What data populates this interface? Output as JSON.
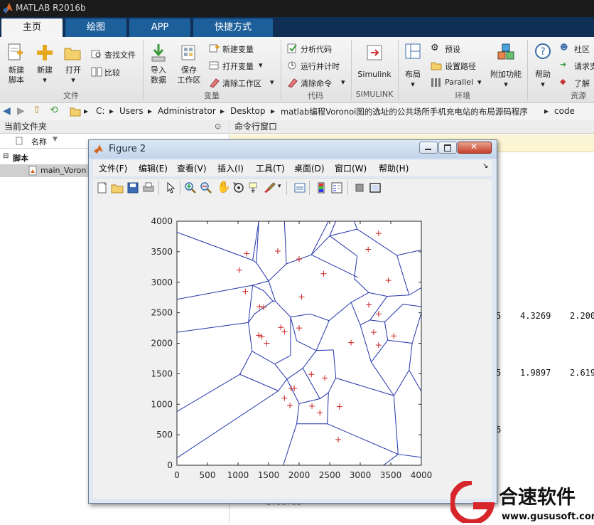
{
  "window": {
    "title": "MATLAB R2016b"
  },
  "tabs": [
    {
      "label": "主页",
      "active": true
    },
    {
      "label": "绘图",
      "active": false
    },
    {
      "label": "APP",
      "active": false
    },
    {
      "label": "快捷方式",
      "active": false
    }
  ],
  "ribbon": {
    "file": {
      "group_label": "文件",
      "new_script": "新建\n脚本",
      "new": "新建",
      "open": "打开",
      "find_files": "查找文件",
      "compare": "比较"
    },
    "variable": {
      "group_label": "变量",
      "import_data": "导入\n数据",
      "save_workspace": "保存\n工作区",
      "new_variable": "新建变量",
      "open_variable": "打开变量",
      "clear_workspace": "清除工作区"
    },
    "code": {
      "group_label": "代码",
      "analyze_code": "分析代码",
      "run_and_time": "运行并计时",
      "clear_commands": "清除命令"
    },
    "simulink": {
      "group_label": "SIMULINK",
      "simulink": "Simulink"
    },
    "environment": {
      "group_label": "环境",
      "layout": "布局",
      "preferences": "预设",
      "set_path": "设置路径",
      "parallel": "Parallel",
      "addons": "附加功能"
    },
    "resources": {
      "group_label": "资源",
      "help": "帮助",
      "community": "社区",
      "request_support": "请求支",
      "learn": "了解"
    }
  },
  "address": {
    "path": [
      "C:",
      "Users",
      "Administrator",
      "Desktop",
      "matlab编程Voronoi图的选址的公共场所手机充电站的布局源码程序",
      "code"
    ]
  },
  "current_folder": {
    "title": "当前文件夹",
    "column_name": "名称",
    "sort_indicator": "▼",
    "group": "脚本",
    "items": [
      {
        "name": "main_Voron"
      }
    ]
  },
  "command_window": {
    "title": "命令行窗口",
    "row1": [
      "5",
      "4.3269",
      "2.200"
    ],
    "row2": [
      "5",
      "1.9897",
      "2.619"
    ],
    "row3": [
      "6"
    ],
    "bottom_line": "1.0e+03"
  },
  "figure": {
    "title": "Figure 2",
    "menus": [
      "文件(F)",
      "编辑(E)",
      "查看(V)",
      "插入(I)",
      "工具(T)",
      "桌面(D)",
      "窗口(W)",
      "帮助(H)"
    ],
    "menu_overflow": "↘"
  },
  "chart_data": {
    "type": "scatter",
    "title": "",
    "xlabel": "",
    "ylabel": "",
    "xlim": [
      0,
      4000
    ],
    "ylim": [
      0,
      4000
    ],
    "xticks": [
      "0",
      "500",
      "1000",
      "1500",
      "2000",
      "2500",
      "3000",
      "3500",
      "4000"
    ],
    "yticks": [
      "0",
      "500",
      "1000",
      "1500",
      "2000",
      "2500",
      "3000",
      "3500",
      "4000"
    ],
    "grid": false,
    "marker": "+",
    "marker_color": "#cc2020",
    "line_color": "#2233aa",
    "points": [
      [
        1140,
        3470
      ],
      [
        1650,
        3510
      ],
      [
        2000,
        3380
      ],
      [
        3300,
        3800
      ],
      [
        3130,
        3540
      ],
      [
        1020,
        3200
      ],
      [
        2400,
        3140
      ],
      [
        3460,
        3030
      ],
      [
        1120,
        2850
      ],
      [
        2040,
        2760
      ],
      [
        1350,
        2600
      ],
      [
        1420,
        2590
      ],
      [
        3140,
        2630
      ],
      [
        3300,
        2480
      ],
      [
        1340,
        2130
      ],
      [
        1390,
        2110
      ],
      [
        1470,
        2000
      ],
      [
        1700,
        2260
      ],
      [
        1760,
        2190
      ],
      [
        2000,
        2250
      ],
      [
        2850,
        2010
      ],
      [
        3220,
        2180
      ],
      [
        3300,
        1970
      ],
      [
        3550,
        2120
      ],
      [
        2200,
        1490
      ],
      [
        2420,
        1430
      ],
      [
        1870,
        1260
      ],
      [
        1920,
        1260
      ],
      [
        1760,
        1100
      ],
      [
        1850,
        980
      ],
      [
        2210,
        970
      ],
      [
        2340,
        860
      ],
      [
        2660,
        960
      ],
      [
        2640,
        420
      ]
    ],
    "edges": [
      [
        [
          0,
          3820
        ],
        [
          1240,
          3360
        ]
      ],
      [
        [
          1240,
          3360
        ],
        [
          1340,
          4000
        ]
      ],
      [
        [
          1340,
          4000
        ],
        [
          1300,
          3320
        ]
      ],
      [
        [
          1300,
          3320
        ],
        [
          1240,
          3360
        ]
      ],
      [
        [
          1300,
          3320
        ],
        [
          1500,
          3020
        ]
      ],
      [
        [
          1500,
          3020
        ],
        [
          1790,
          3300
        ]
      ],
      [
        [
          1790,
          3300
        ],
        [
          1760,
          4000
        ]
      ],
      [
        [
          1790,
          3300
        ],
        [
          2200,
          3450
        ]
      ],
      [
        [
          2200,
          3450
        ],
        [
          2480,
          4000
        ]
      ],
      [
        [
          2200,
          3450
        ],
        [
          2500,
          3760
        ]
      ],
      [
        [
          2500,
          3760
        ],
        [
          2600,
          4000
        ]
      ],
      [
        [
          2500,
          3760
        ],
        [
          2950,
          3870
        ]
      ],
      [
        [
          2950,
          3870
        ],
        [
          2900,
          4000
        ]
      ],
      [
        [
          2950,
          3870
        ],
        [
          3600,
          3440
        ]
      ],
      [
        [
          3600,
          3440
        ],
        [
          4000,
          3530
        ]
      ],
      [
        [
          2500,
          3760
        ],
        [
          2950,
          3430
        ]
      ],
      [
        [
          2950,
          3430
        ],
        [
          2900,
          3060
        ]
      ],
      [
        [
          2900,
          3060
        ],
        [
          3140,
          2830
        ]
      ],
      [
        [
          3140,
          2830
        ],
        [
          3440,
          2770
        ]
      ],
      [
        [
          3440,
          2770
        ],
        [
          3800,
          2790
        ]
      ],
      [
        [
          3800,
          2790
        ],
        [
          4000,
          2910
        ]
      ],
      [
        [
          3600,
          3440
        ],
        [
          3800,
          2790
        ]
      ],
      [
        [
          2200,
          3450
        ],
        [
          2960,
          3080
        ]
      ],
      [
        [
          1500,
          3020
        ],
        [
          1610,
          2690
        ]
      ],
      [
        [
          1610,
          2690
        ],
        [
          1860,
          2430
        ]
      ],
      [
        [
          1860,
          2430
        ],
        [
          2180,
          2480
        ]
      ],
      [
        [
          2180,
          2480
        ],
        [
          2490,
          2370
        ]
      ],
      [
        [
          2490,
          2370
        ],
        [
          2850,
          2670
        ]
      ],
      [
        [
          2850,
          2670
        ],
        [
          3140,
          2830
        ]
      ],
      [
        [
          2850,
          2670
        ],
        [
          3000,
          2300
        ]
      ],
      [
        [
          3000,
          2300
        ],
        [
          3160,
          2380
        ]
      ],
      [
        [
          3160,
          2380
        ],
        [
          3440,
          2770
        ]
      ],
      [
        [
          3160,
          2380
        ],
        [
          3400,
          2350
        ]
      ],
      [
        [
          3400,
          2350
        ],
        [
          3700,
          2640
        ]
      ],
      [
        [
          3700,
          2640
        ],
        [
          4000,
          2600
        ]
      ],
      [
        [
          3400,
          2350
        ],
        [
          3450,
          2050
        ]
      ],
      [
        [
          3450,
          2050
        ],
        [
          3850,
          2000
        ]
      ],
      [
        [
          3850,
          2000
        ],
        [
          4000,
          2500
        ]
      ],
      [
        [
          3850,
          2000
        ],
        [
          3800,
          1560
        ]
      ],
      [
        [
          3800,
          1560
        ],
        [
          4000,
          1210
        ]
      ],
      [
        [
          3450,
          2050
        ],
        [
          3180,
          1690
        ]
      ],
      [
        [
          3180,
          1690
        ],
        [
          3000,
          2300
        ]
      ],
      [
        [
          3180,
          1690
        ],
        [
          3550,
          1140
        ]
      ],
      [
        [
          3550,
          1140
        ],
        [
          3800,
          1560
        ]
      ],
      [
        [
          3550,
          1140
        ],
        [
          3620,
          180
        ]
      ],
      [
        [
          3620,
          180
        ],
        [
          4000,
          130
        ]
      ],
      [
        [
          3620,
          180
        ],
        [
          3380,
          0
        ]
      ],
      [
        [
          0,
          2720
        ],
        [
          1240,
          2950
        ]
      ],
      [
        [
          1240,
          2950
        ],
        [
          1500,
          3020
        ]
      ],
      [
        [
          1240,
          2950
        ],
        [
          1420,
          2860
        ]
      ],
      [
        [
          1420,
          2860
        ],
        [
          1570,
          2690
        ]
      ],
      [
        [
          1570,
          2690
        ],
        [
          1610,
          2690
        ]
      ],
      [
        [
          1240,
          2950
        ],
        [
          1170,
          2340
        ]
      ],
      [
        [
          1170,
          2340
        ],
        [
          1270,
          2480
        ]
      ],
      [
        [
          1270,
          2480
        ],
        [
          1570,
          2690
        ]
      ],
      [
        [
          0,
          2180
        ],
        [
          1170,
          2340
        ]
      ],
      [
        [
          1170,
          2340
        ],
        [
          1230,
          1870
        ]
      ],
      [
        [
          1230,
          1870
        ],
        [
          1600,
          1660
        ]
      ],
      [
        [
          1600,
          1660
        ],
        [
          1860,
          1800
        ]
      ],
      [
        [
          1860,
          1800
        ],
        [
          1860,
          2430
        ]
      ],
      [
        [
          1600,
          1660
        ],
        [
          1800,
          1410
        ]
      ],
      [
        [
          1800,
          1410
        ],
        [
          2060,
          1590
        ]
      ],
      [
        [
          2060,
          1590
        ],
        [
          2280,
          1880
        ]
      ],
      [
        [
          2280,
          1880
        ],
        [
          2490,
          2370
        ]
      ],
      [
        [
          2280,
          1880
        ],
        [
          2560,
          1890
        ]
      ],
      [
        [
          2560,
          1890
        ],
        [
          2600,
          1430
        ]
      ],
      [
        [
          2600,
          1430
        ],
        [
          3550,
          1140
        ]
      ],
      [
        [
          2600,
          1430
        ],
        [
          2480,
          1190
        ]
      ],
      [
        [
          2480,
          1190
        ],
        [
          2340,
          1090
        ]
      ],
      [
        [
          2340,
          1090
        ],
        [
          2060,
          1590
        ]
      ],
      [
        [
          2340,
          1090
        ],
        [
          2000,
          1010
        ]
      ],
      [
        [
          2000,
          1010
        ],
        [
          1800,
          1410
        ]
      ],
      [
        [
          2000,
          1010
        ],
        [
          1960,
          680
        ]
      ],
      [
        [
          1960,
          680
        ],
        [
          1740,
          0
        ]
      ],
      [
        [
          1960,
          680
        ],
        [
          2460,
          680
        ]
      ],
      [
        [
          2460,
          680
        ],
        [
          2480,
          1190
        ]
      ],
      [
        [
          2460,
          680
        ],
        [
          3620,
          180
        ]
      ],
      [
        [
          0,
          880
        ],
        [
          1030,
          1490
        ]
      ],
      [
        [
          1030,
          1490
        ],
        [
          1230,
          1870
        ]
      ],
      [
        [
          1030,
          1490
        ],
        [
          1660,
          1220
        ]
      ],
      [
        [
          1660,
          1220
        ],
        [
          1800,
          1410
        ]
      ],
      [
        [
          0,
          120
        ],
        [
          1660,
          1220
        ]
      ],
      [
        [
          1860,
          2430
        ],
        [
          1960,
          2040
        ]
      ],
      [
        [
          1960,
          2040
        ],
        [
          2280,
          1880
        ]
      ]
    ]
  }
}
